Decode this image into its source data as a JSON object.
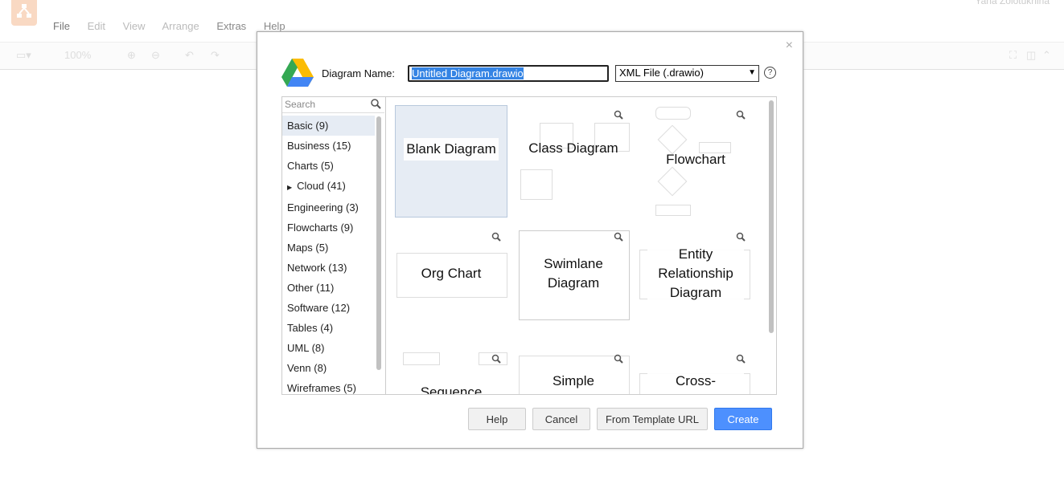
{
  "app": {
    "logo_icon": "drawio-logo-icon",
    "menu": [
      "File",
      "Edit",
      "View",
      "Arrange",
      "Extras",
      "Help"
    ],
    "user": "Yana Zolotukhina",
    "zoom": "100%"
  },
  "dialog": {
    "diagram_name_label": "Diagram Name:",
    "diagram_name_value": "Untitled Diagram.drawio",
    "format_value": "XML File (.drawio)",
    "help_icon": "?",
    "close": "×",
    "search_placeholder": "Search",
    "categories": [
      {
        "label": "Basic (9)",
        "selected": true
      },
      {
        "label": "Business (15)"
      },
      {
        "label": "Charts (5)"
      },
      {
        "label": "Cloud (41)",
        "expandable": true
      },
      {
        "label": "Engineering (3)"
      },
      {
        "label": "Flowcharts (9)"
      },
      {
        "label": "Maps (5)"
      },
      {
        "label": "Network (13)"
      },
      {
        "label": "Other (11)"
      },
      {
        "label": "Software (12)"
      },
      {
        "label": "Tables (4)"
      },
      {
        "label": "UML (8)"
      },
      {
        "label": "Venn (8)"
      },
      {
        "label": "Wireframes (5)"
      }
    ],
    "templates": [
      {
        "label": "Blank Diagram",
        "selected": true
      },
      {
        "label": "Class Diagram"
      },
      {
        "label": "Flowchart"
      },
      {
        "label": "Org Chart"
      },
      {
        "label": "Swimlane Diagram"
      },
      {
        "label": "Entity Relationship Diagram"
      },
      {
        "label": "Sequence"
      },
      {
        "label": "Simple"
      },
      {
        "label": "Cross-"
      }
    ],
    "buttons": {
      "help": "Help",
      "cancel": "Cancel",
      "from_template_url": "From Template URL",
      "create": "Create"
    }
  },
  "colors": {
    "primary": "#4d90fe",
    "selection": "#e6ecf4"
  }
}
